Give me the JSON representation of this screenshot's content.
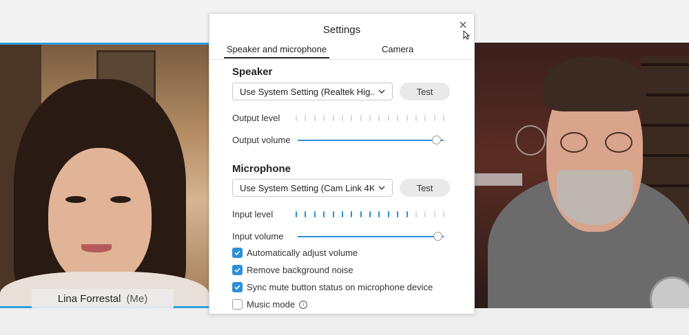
{
  "dialog": {
    "title": "Settings",
    "tabs": [
      {
        "label": "Speaker and microphone",
        "active": true
      },
      {
        "label": "Camera",
        "active": false
      }
    ]
  },
  "speaker": {
    "title": "Speaker",
    "device": "Use System Setting (Realtek Hig...",
    "test_label": "Test",
    "output_level_label": "Output level",
    "output_level_active_ticks": 0,
    "output_volume_label": "Output volume",
    "output_volume_fraction": 0.98
  },
  "microphone": {
    "title": "Microphone",
    "device": "Use System Setting (Cam Link 4K)",
    "test_label": "Test",
    "input_level_label": "Input level",
    "input_level_active_ticks": 13,
    "input_volume_label": "Input volume",
    "input_volume_fraction": 0.99
  },
  "options": [
    {
      "label": "Automatically adjust volume",
      "checked": true
    },
    {
      "label": "Remove background noise",
      "checked": true
    },
    {
      "label": "Sync mute button status on microphone device",
      "checked": true
    },
    {
      "label": "Music mode",
      "checked": false
    }
  ],
  "participants": {
    "left_name": "Lina Forrestal",
    "left_suffix": "(Me)"
  },
  "colors": {
    "accent": "#2b8fd9",
    "active_speaker_border": "#2d9fe0"
  },
  "icons": {
    "close": "close-icon",
    "dropdown": "chevron-down-icon",
    "checkbox": "checkmark-icon",
    "info": "info-icon",
    "cursor": "cursor-icon"
  }
}
